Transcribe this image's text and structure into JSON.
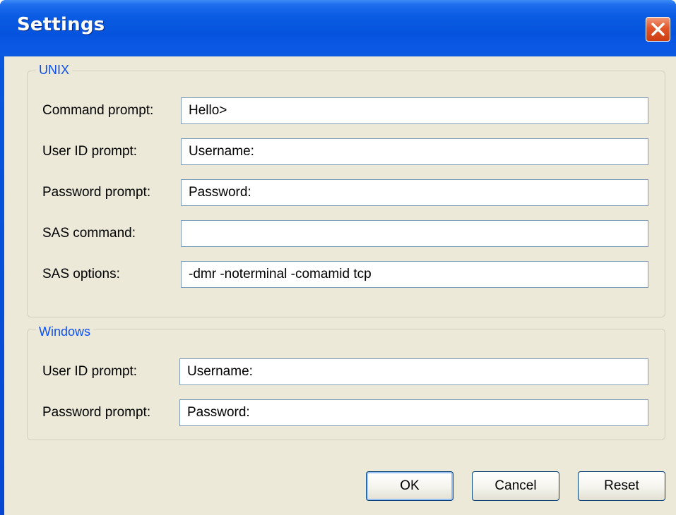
{
  "window": {
    "title": "Settings"
  },
  "unix": {
    "legend": "UNIX",
    "rows": [
      {
        "label": "Command prompt:",
        "value": "Hello>"
      },
      {
        "label": "User ID prompt:",
        "value": "Username:"
      },
      {
        "label": "Password prompt:",
        "value": "Password:"
      },
      {
        "label": "SAS command:",
        "value": ""
      },
      {
        "label": "SAS options:",
        "value": "-dmr -noterminal -comamid tcp"
      }
    ]
  },
  "windows": {
    "legend": "Windows",
    "rows": [
      {
        "label": "User ID prompt:",
        "value": "Username:"
      },
      {
        "label": "Password prompt:",
        "value": "Password:"
      }
    ]
  },
  "buttons": {
    "ok": "OK",
    "cancel": "Cancel",
    "reset": "Reset"
  },
  "icons": {
    "close": "close-icon"
  },
  "colors": {
    "titlebar": "#0a5ae2",
    "dialog_bg": "#ece9d8",
    "legend_text": "#0d4ef0",
    "close_button": "#e2552a",
    "field_border": "#7f9db9"
  }
}
